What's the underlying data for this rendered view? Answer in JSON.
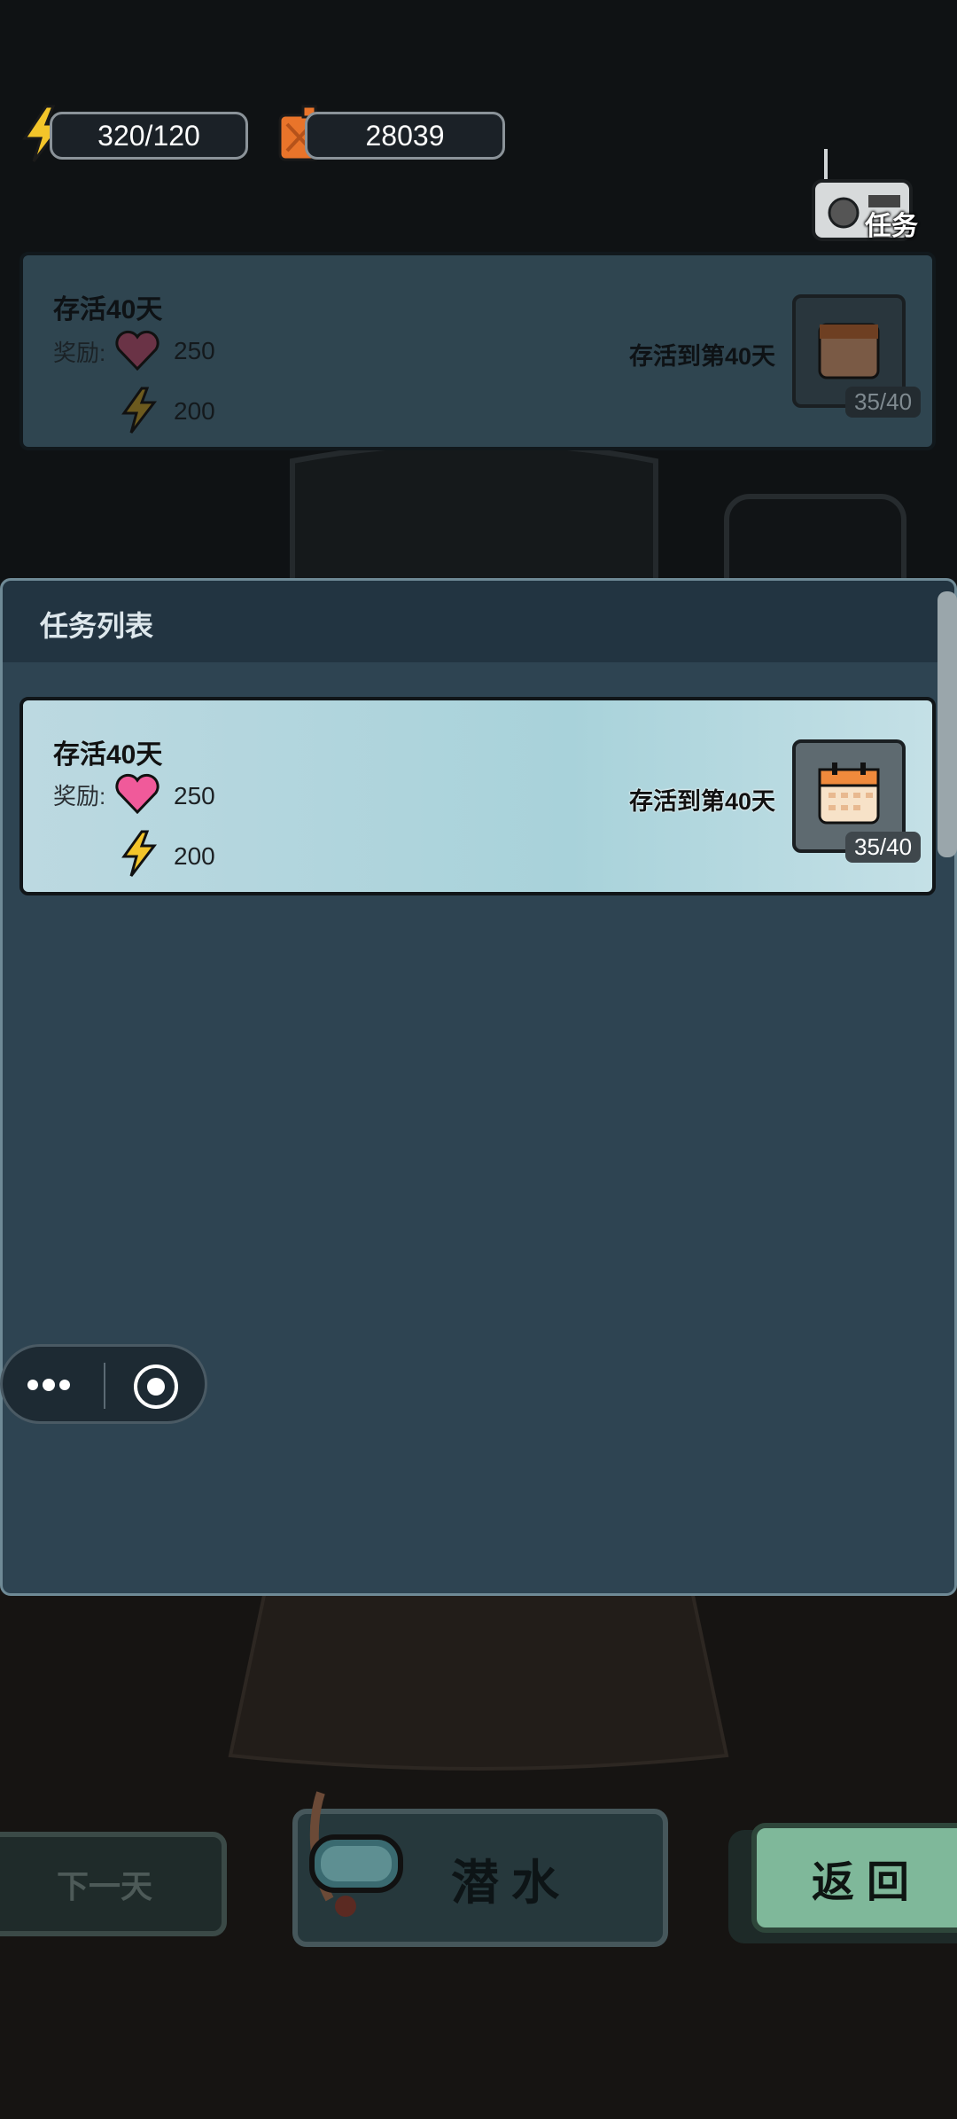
{
  "resources": {
    "energy": "320/120",
    "fuel": "28039"
  },
  "task_button_label": "任务",
  "top_task": {
    "title": "存活40天",
    "reward_label": "奖励:",
    "reward_hearts": "250",
    "reward_energy": "200",
    "goal": "存活到第40天",
    "progress": "35/40"
  },
  "task_panel": {
    "title": "任务列表",
    "tasks": [
      {
        "title": "存活40天",
        "reward_label": "奖励:",
        "reward_hearts": "250",
        "reward_energy": "200",
        "goal": "存活到第40天",
        "progress": "35/40"
      }
    ]
  },
  "bottom": {
    "next_day": "下一天",
    "dive": "潜水",
    "back": "返回"
  },
  "colors": {
    "panel_bg": "#2e4452",
    "card_bg": "#a9cdd6",
    "back_button": "#7fb89a",
    "energy": "#f3c52a",
    "fuel": "#e9742a",
    "heart": "#f05a9a"
  }
}
